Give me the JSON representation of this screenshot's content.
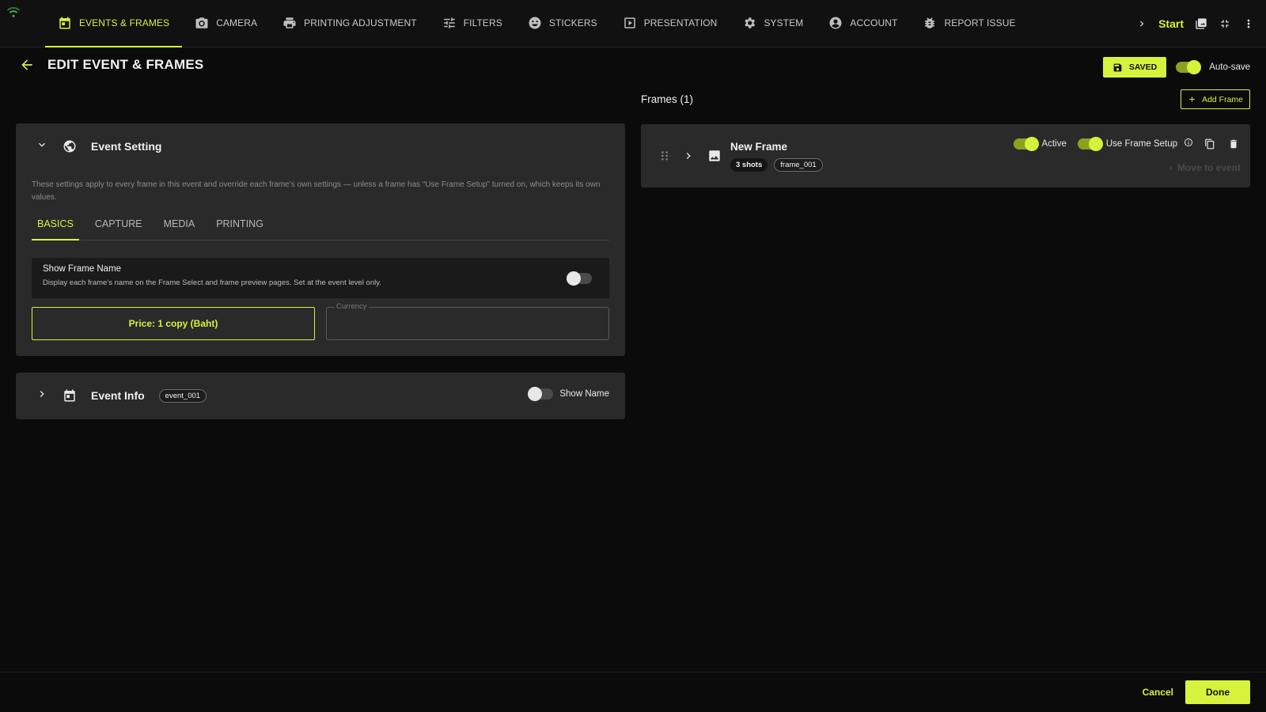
{
  "nav": {
    "tabs": [
      {
        "label": "EVENTS & FRAMES",
        "icon": "calendar-icon",
        "active": true
      },
      {
        "label": "CAMERA",
        "icon": "camera-icon"
      },
      {
        "label": "PRINTING ADJUSTMENT",
        "icon": "printer-icon"
      },
      {
        "label": "FILTERS",
        "icon": "sliders-icon"
      },
      {
        "label": "STICKERS",
        "icon": "sticker-icon"
      },
      {
        "label": "PRESENTATION",
        "icon": "play-icon"
      },
      {
        "label": "SYSTEM",
        "icon": "gear-icon"
      },
      {
        "label": "ACCOUNT",
        "icon": "account-icon"
      },
      {
        "label": "REPORT ISSUE",
        "icon": "bug-icon"
      }
    ],
    "start_label": "Start"
  },
  "header": {
    "title": "EDIT EVENT & FRAMES",
    "saved_label": "SAVED",
    "autosave_label": "Auto-save",
    "autosave_on": true
  },
  "event_setting": {
    "title": "Event Setting",
    "description": "These settings apply to every frame in this event and override each frame’s own settings — unless a frame has “Use Frame Setup” turned on, which keeps its own values.",
    "tabs": [
      "BASICS",
      "CAPTURE",
      "MEDIA",
      "PRINTING"
    ],
    "active_tab": "BASICS",
    "show_frame_name": {
      "title": "Show Frame Name",
      "description": "Display each frame’s name on the Frame Select and frame preview pages. Set at the event level only.",
      "enabled": false
    },
    "price_button_label": "Price: 1 copy (Baht)",
    "currency_label": "Currency",
    "currency_value": ""
  },
  "event_info": {
    "title": "Event Info",
    "id_badge": "event_001",
    "show_name_label": "Show Name",
    "show_name_on": false
  },
  "frames": {
    "title": "Frames (1)",
    "add_label": "Add Frame",
    "items": [
      {
        "name": "New Frame",
        "shots": "3 shots",
        "id": "frame_001",
        "active_label": "Active",
        "active_on": true,
        "use_setup_label": "Use Frame Setup",
        "use_setup_on": true,
        "move_label": "Move to event"
      }
    ]
  },
  "footer": {
    "cancel_label": "Cancel",
    "done_label": "Done"
  },
  "colors": {
    "accent": "#d6f23c",
    "background": "#0b0b0b",
    "panel": "#2a2a2a"
  }
}
